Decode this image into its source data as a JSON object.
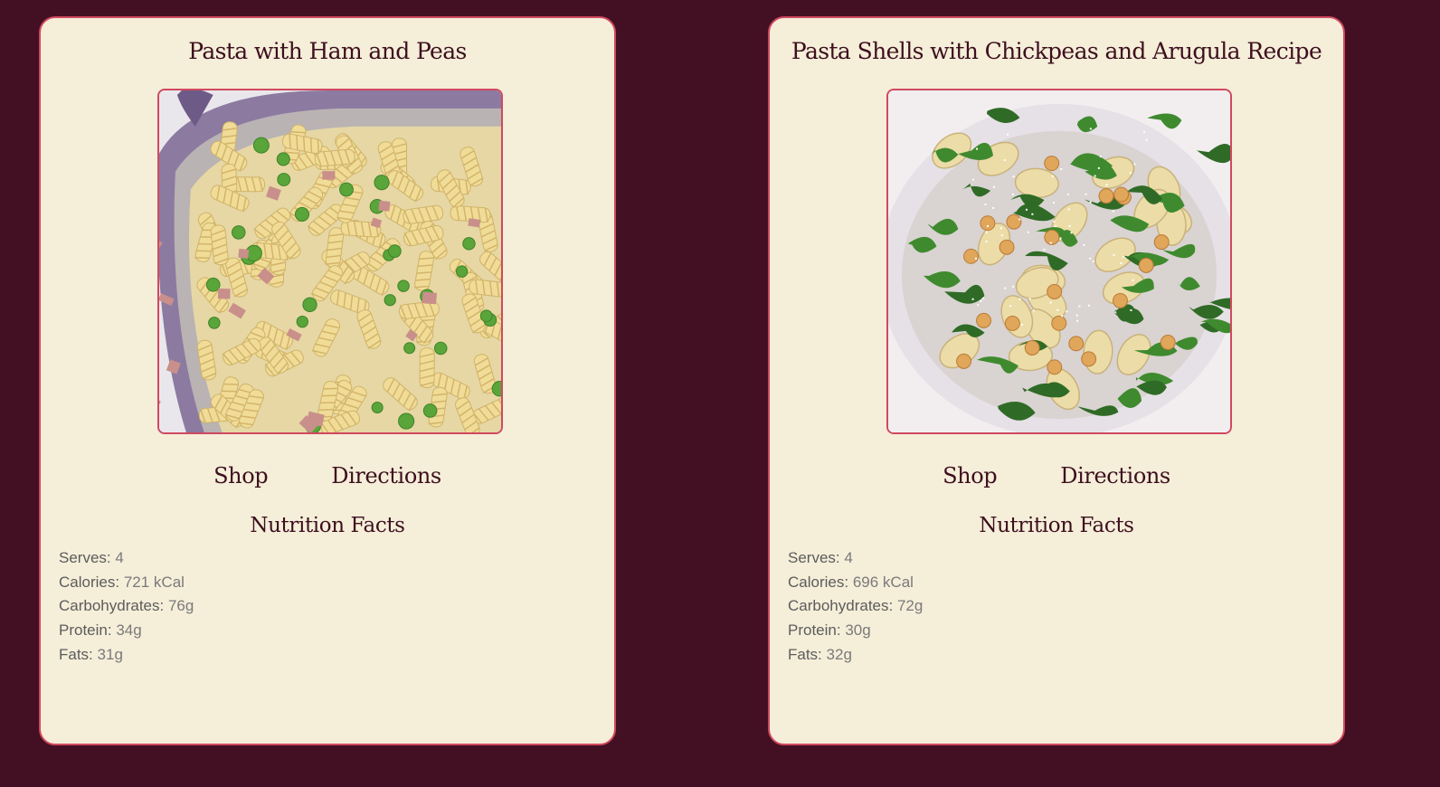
{
  "colors": {
    "background": "#431023",
    "card": "#f5eed9",
    "card_border": "#d0495f",
    "text": "#3d0f1e"
  },
  "recipes": [
    {
      "title": "Pasta with Ham and Peas",
      "image": "pasta-fusilli-ham-peas-photo",
      "shop_label": "Shop",
      "directions_label": "Directions",
      "nutrition_title": "Nutrition Facts",
      "facts": [
        {
          "label": "Serves:",
          "value": "4"
        },
        {
          "label": "Calories:",
          "value": "721 kCal"
        },
        {
          "label": "Carbohydrates:",
          "value": "76g"
        },
        {
          "label": "Protein:",
          "value": "34g"
        },
        {
          "label": "Fats:",
          "value": "31g"
        }
      ]
    },
    {
      "title": "Pasta Shells with Chickpeas and Arugula Recipe",
      "image": "pasta-shells-chickpeas-arugula-photo",
      "shop_label": "Shop",
      "directions_label": "Directions",
      "nutrition_title": "Nutrition Facts",
      "facts": [
        {
          "label": "Serves:",
          "value": "4"
        },
        {
          "label": "Calories:",
          "value": "696 kCal"
        },
        {
          "label": "Carbohydrates:",
          "value": "72g"
        },
        {
          "label": "Protein:",
          "value": "30g"
        },
        {
          "label": "Fats:",
          "value": "32g"
        }
      ]
    }
  ]
}
